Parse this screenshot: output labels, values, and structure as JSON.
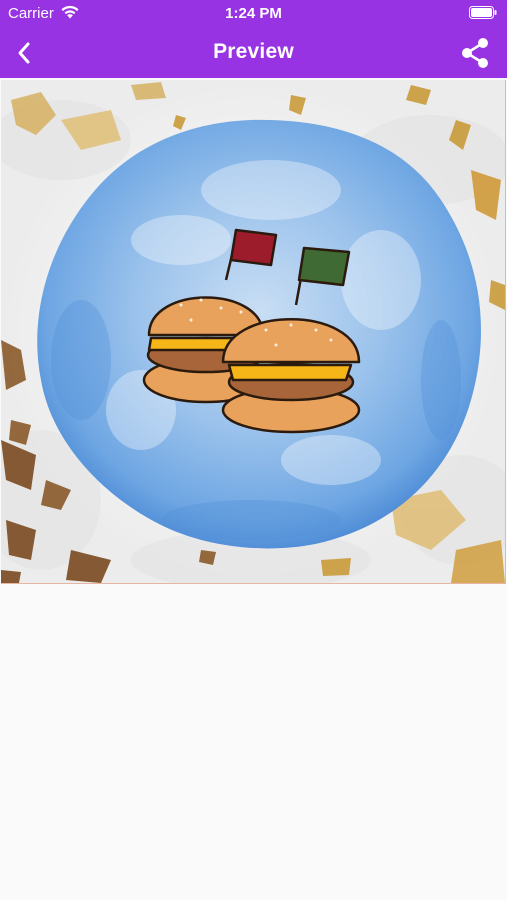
{
  "status_bar": {
    "carrier": "Carrier",
    "time": "1:24 PM",
    "wifi_icon": "wifi-icon",
    "battery_icon": "battery-icon"
  },
  "nav": {
    "title": "Preview",
    "back_icon": "chevron-left-icon",
    "share_icon": "share-icon"
  },
  "preview": {
    "image": "burger-sliders-watercolor-logo"
  },
  "colors": {
    "nav_background": "#9733e3",
    "nav_text": "#ffffff",
    "page_background": "#fafafa",
    "watercolor_blue": "#7fb3ea",
    "gold_fleck": "#c89a3c",
    "flag_red": "#9d1c2c",
    "flag_green": "#3f6a34",
    "bun": "#e9a25c",
    "cheese": "#f6b617",
    "patty": "#a8653a"
  }
}
